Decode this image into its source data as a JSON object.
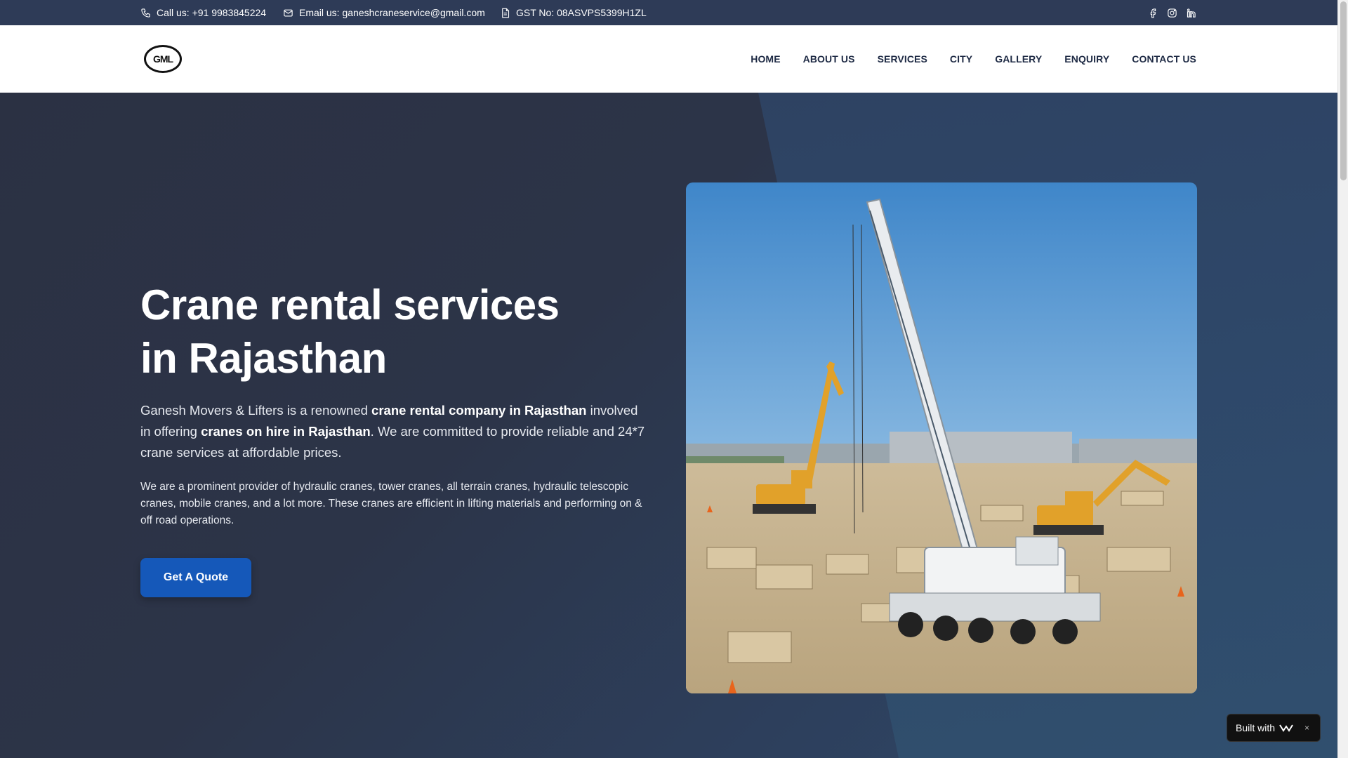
{
  "topbar": {
    "phone": "Call us: +91 9983845224",
    "email": "Email us: ganeshcraneservice@gmail.com",
    "gst": "GST No: 08ASVPS5399H1ZL",
    "social_icons": [
      "facebook-icon",
      "instagram-icon",
      "linkedin-icon"
    ]
  },
  "header": {
    "logo_text": "GML",
    "nav": [
      "HOME",
      "ABOUT US",
      "SERVICES",
      "CITY",
      "GALLERY",
      "ENQUIRY",
      "CONTACT US"
    ]
  },
  "hero": {
    "title_line1": "Crane rental services",
    "title_line2": "in Rajasthan",
    "lead": {
      "t1": "Ganesh Movers & Lifters is a renowned ",
      "b1": "crane rental company in Rajasthan",
      "t2": " involved in offering ",
      "b2": "cranes on hire in Rajasthan",
      "t3": ". We are committed to provide reliable and 24*7 crane services at affordable prices."
    },
    "paragraph": "We are a prominent provider of hydraulic cranes, tower cranes, all terrain cranes, hydraulic telescopic cranes, mobile cranes, and a lot more. These cranes are efficient in lifting materials and performing on & off road operations.",
    "cta_label": "Get A Quote"
  },
  "badge": {
    "label": "Built with",
    "close": "×"
  },
  "colors": {
    "topbar_bg": "#2e3b57",
    "nav_text": "#1e2a44",
    "cta_bg": "#1558b9"
  }
}
